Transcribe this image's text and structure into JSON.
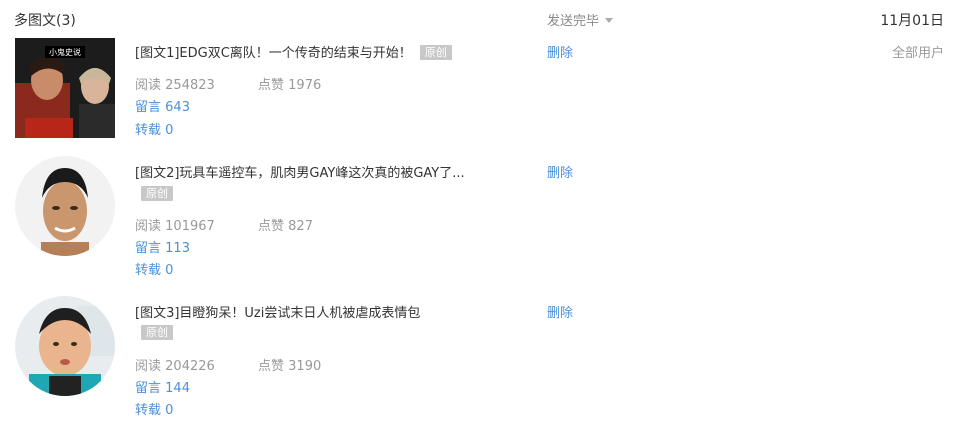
{
  "header": {
    "title": "多图文(3)",
    "status": "发送完毕",
    "date": "11月01日"
  },
  "items": [
    {
      "title": "[图文1]EDG双C离队！一个传奇的结束与开始！",
      "badge": "原创",
      "read_label": "阅读",
      "read_count": "254823",
      "like_label": "点赞",
      "like_count": "1976",
      "comment_label": "留言",
      "comment_count": "643",
      "repost_label": "转载",
      "repost_count": "0",
      "delete_label": "删除",
      "audience": "全部用户",
      "thumb_text": "小鬼史说"
    },
    {
      "title": "[图文2]玩具车遥控车，肌肉男GAY峰这次真的被GAY了...",
      "badge": "原创",
      "read_label": "阅读",
      "read_count": "101967",
      "like_label": "点赞",
      "like_count": "827",
      "comment_label": "留言",
      "comment_count": "113",
      "repost_label": "转载",
      "repost_count": "0",
      "delete_label": "删除"
    },
    {
      "title": "[图文3]目瞪狗呆！Uzi尝试末日人机被虐成表情包",
      "badge": "原创",
      "read_label": "阅读",
      "read_count": "204226",
      "like_label": "点赞",
      "like_count": "3190",
      "comment_label": "留言",
      "comment_count": "144",
      "repost_label": "转载",
      "repost_count": "0",
      "delete_label": "删除"
    }
  ]
}
